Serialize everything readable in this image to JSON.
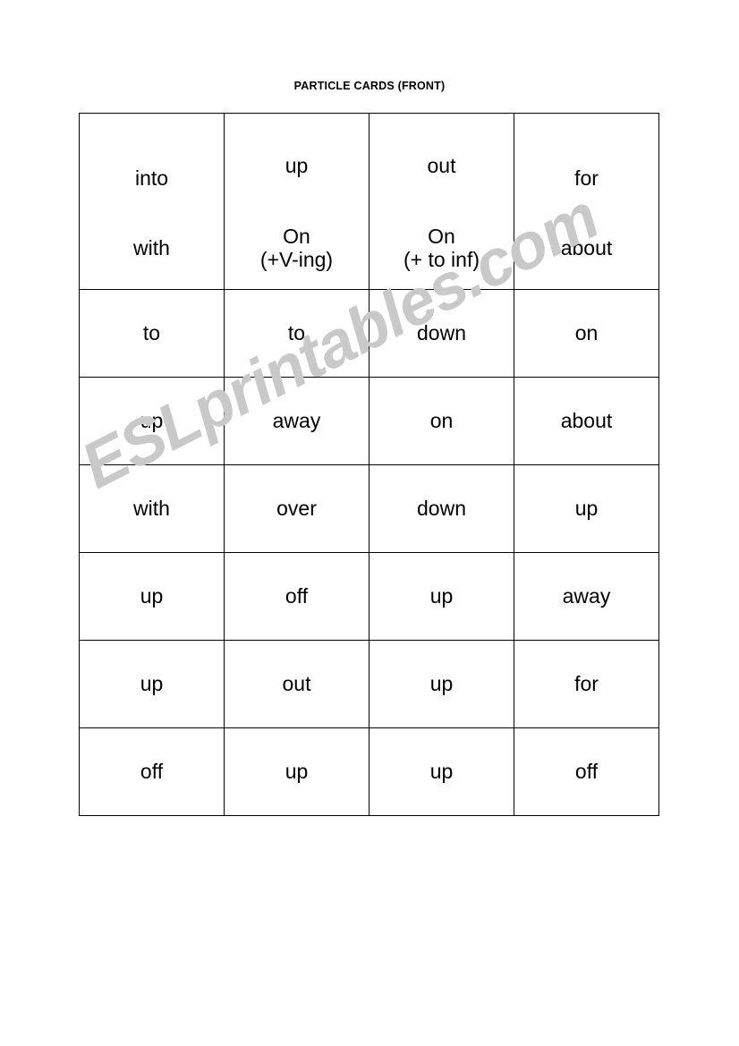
{
  "document": {
    "title": "PARTICLE CARDS (FRONT)"
  },
  "watermark": {
    "text": "ESLprintables.com",
    "color": "#c9c9c9"
  },
  "table": {
    "columns": 4,
    "rows": [
      {
        "type": "tall",
        "cells": [
          {
            "line1": "into",
            "line2": "with",
            "line2_sub": ""
          },
          {
            "line1": "up",
            "line2": "On",
            "line2_sub": "(+V-ing)"
          },
          {
            "line1": "out",
            "line2": "On",
            "line2_sub": "(+ to inf)"
          },
          {
            "line1": "for",
            "line2": "about",
            "line2_sub": ""
          }
        ]
      },
      {
        "type": "normal",
        "cells": [
          {
            "line1": "to"
          },
          {
            "line1": "to"
          },
          {
            "line1": "down"
          },
          {
            "line1": "on"
          }
        ]
      },
      {
        "type": "normal",
        "cells": [
          {
            "line1": "up"
          },
          {
            "line1": "away"
          },
          {
            "line1": "on"
          },
          {
            "line1": "about"
          }
        ]
      },
      {
        "type": "normal",
        "cells": [
          {
            "line1": "with"
          },
          {
            "line1": "over"
          },
          {
            "line1": "down"
          },
          {
            "line1": "up"
          }
        ]
      },
      {
        "type": "normal",
        "cells": [
          {
            "line1": "up"
          },
          {
            "line1": "off"
          },
          {
            "line1": "up"
          },
          {
            "line1": "away"
          }
        ]
      },
      {
        "type": "normal",
        "cells": [
          {
            "line1": "up"
          },
          {
            "line1": "out"
          },
          {
            "line1": "up"
          },
          {
            "line1": "for"
          }
        ]
      },
      {
        "type": "normal",
        "cells": [
          {
            "line1": "off"
          },
          {
            "line1": "up"
          },
          {
            "line1": "up"
          },
          {
            "line1": "off"
          }
        ]
      }
    ]
  }
}
